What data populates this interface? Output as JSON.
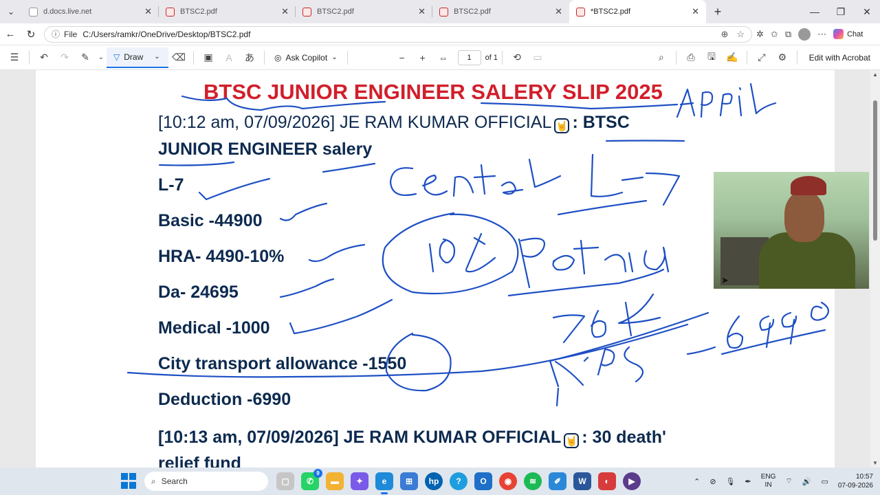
{
  "browser": {
    "tabs": [
      {
        "label": "d.docs.live.net",
        "type": "doc"
      },
      {
        "label": "BTSC2.pdf",
        "type": "pdf"
      },
      {
        "label": "BTSC2.pdf",
        "type": "pdf"
      },
      {
        "label": "BTSC2.pdf",
        "type": "pdf"
      },
      {
        "label": "*BTSC2.pdf",
        "type": "pdf",
        "active": true
      }
    ],
    "address": {
      "scheme_label": "File",
      "url": "C:/Users/ramkr/OneDrive/Desktop/BTSC2.pdf"
    },
    "chat_label": "Chat"
  },
  "pdf_toolbar": {
    "draw_label": "Draw",
    "ask_copilot_label": "Ask Copilot",
    "page_number": "1",
    "page_total": "of 1",
    "edit_label": "Edit with Acrobat"
  },
  "document": {
    "title": "BTSC JUNIOR ENGINEER SALERY SLIP 2025",
    "msg1_prefix": "[10:12 am, 07/09/2026] JE RAM KUMAR OFFICIAL",
    "msg1_suffix": ": BTSC",
    "msg1_cont": "JUNIOR ENGINEER salery",
    "items": [
      "L-7",
      "Basic -44900",
      "HRA- 4490-10%",
      "Da- 24695",
      "Medical -1000",
      "City transport allowance -1550",
      "Deduction -6990"
    ],
    "msg2_prefix": "[10:13 am, 07/09/2026] JE RAM KUMAR OFFICIAL",
    "msg2_suffix": ": 30 death'",
    "msg2_cont": "relief fund"
  },
  "annotations": {
    "ink_color": "#1d4fc4",
    "texts": [
      "April",
      "Central",
      "L-7",
      "10%",
      "Patna",
      "76k",
      "NPS -6990"
    ]
  },
  "taskbar": {
    "search_placeholder": "Search",
    "badge_count": "9",
    "lang_top": "ENG",
    "lang_bottom": "IN",
    "time": "10:57",
    "date": "07-09-2026"
  }
}
